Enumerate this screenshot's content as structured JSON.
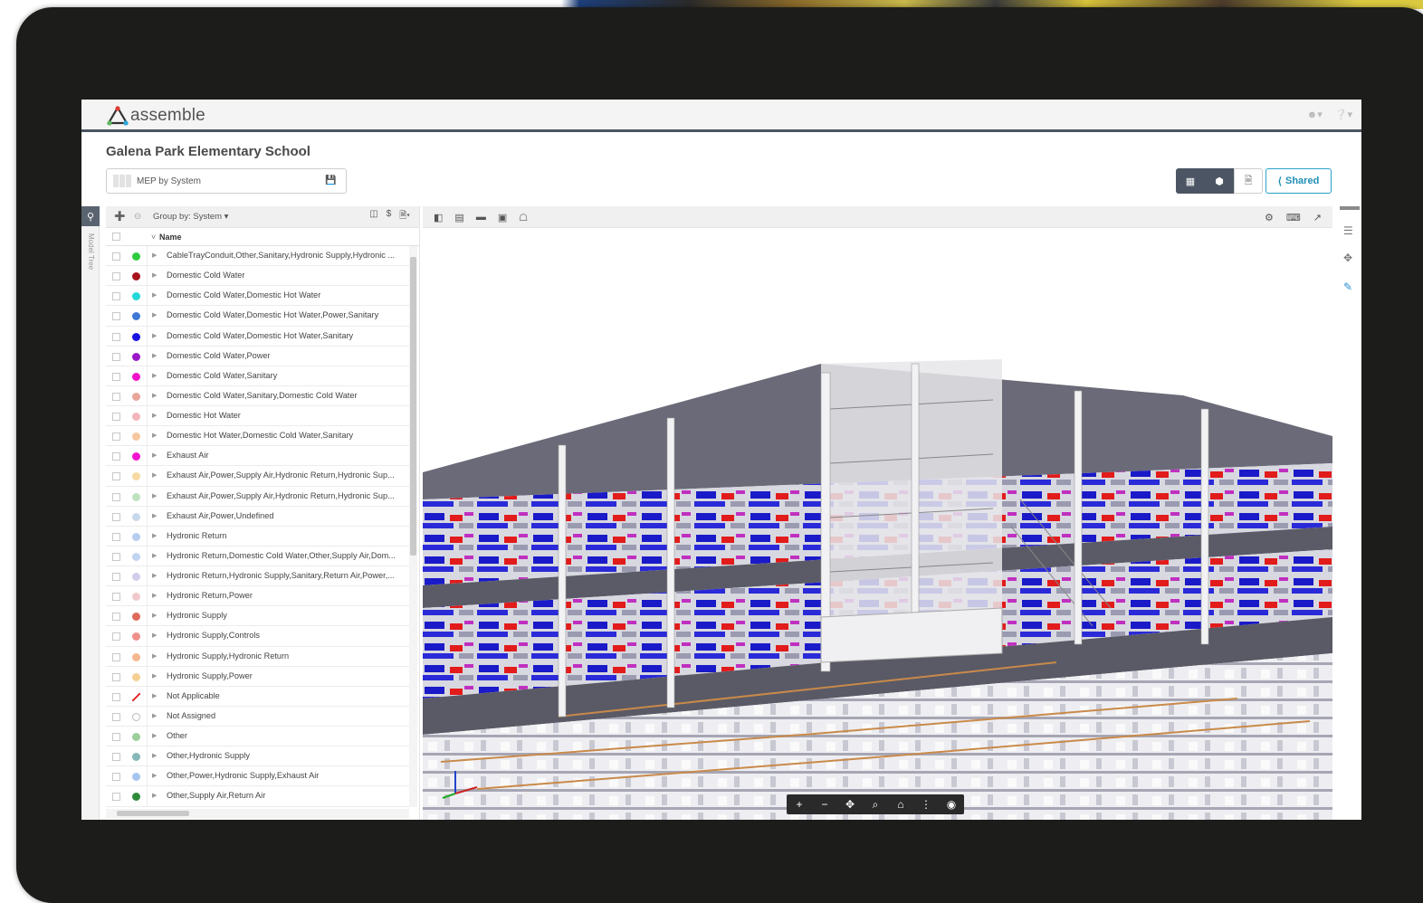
{
  "app": {
    "brand": "assemble",
    "project_title": "Galena Park Elementary School",
    "view_name": "MEP by System",
    "shared_label": "Shared",
    "rail_label": "Model Tree"
  },
  "icons": {
    "user": "user-icon",
    "help": "help-icon",
    "grid": "grid-view-icon",
    "model": "model-view-icon",
    "doc": "document-icon",
    "share": "share-icon"
  },
  "tree": {
    "group_by": "Group by: System",
    "column_name": "Name",
    "rows": [
      {
        "label": "CableTrayConduit,Other,Sanitary,Hydronic Supply,Hydronic ...",
        "color": "#2ecc40"
      },
      {
        "label": "Domestic Cold Water",
        "color": "#a8121a"
      },
      {
        "label": "Domestic Cold Water,Domestic Hot Water",
        "color": "#22d8d8"
      },
      {
        "label": "Domestic Cold Water,Domestic Hot Water,Power,Sanitary",
        "color": "#3f78d6"
      },
      {
        "label": "Domestic Cold Water,Domestic Hot Water,Sanitary",
        "color": "#1b14e0"
      },
      {
        "label": "Domestic Cold Water,Power",
        "color": "#9a18c8"
      },
      {
        "label": "Domestic Cold Water,Sanitary",
        "color": "#f012c8"
      },
      {
        "label": "Domestic Cold Water,Sanitary,Domestic Cold Water",
        "color": "#e9a59a"
      },
      {
        "label": "Domestic Hot Water",
        "color": "#f3b5b9"
      },
      {
        "label": "Domestic Hot Water,Domestic Cold Water,Sanitary",
        "color": "#f7c7a0"
      },
      {
        "label": "Exhaust Air",
        "color": "#f212d0"
      },
      {
        "label": "Exhaust Air,Power,Supply Air,Hydronic Return,Hydronic Sup...",
        "color": "#f8d9a0"
      },
      {
        "label": "Exhaust Air,Power,Supply Air,Hydronic Return,Hydronic Sup...",
        "color": "#bfe2bf"
      },
      {
        "label": "Exhaust Air,Power,Undefined",
        "color": "#c8d8ea"
      },
      {
        "label": "Hydronic Return",
        "color": "#b8cdee"
      },
      {
        "label": "Hydronic Return,Domestic Cold Water,Other,Supply Air,Dom...",
        "color": "#c0d4f2"
      },
      {
        "label": "Hydronic Return,Hydronic Supply,Sanitary,Return Air,Power,...",
        "color": "#d2cdea"
      },
      {
        "label": "Hydronic Return,Power",
        "color": "#f0c8cc"
      },
      {
        "label": "Hydronic Supply",
        "color": "#e06a5a"
      },
      {
        "label": "Hydronic Supply,Controls",
        "color": "#f0908a"
      },
      {
        "label": "Hydronic Supply,Hydronic Return",
        "color": "#f4b78e"
      },
      {
        "label": "Hydronic Supply,Power",
        "color": "#f6cf92"
      },
      {
        "label": "Not Applicable",
        "color": "none-red"
      },
      {
        "label": "Not Assigned",
        "color": "#ffffff"
      },
      {
        "label": "Other",
        "color": "#9ccf9c"
      },
      {
        "label": "Other,Hydronic Supply",
        "color": "#86b8b8"
      },
      {
        "label": "Other,Power,Hydronic Supply,Exhaust Air",
        "color": "#a6c6f0"
      },
      {
        "label": "Other,Supply Air,Return Air",
        "color": "#2e8b3a"
      }
    ]
  },
  "viewer": {
    "nav_tools": [
      "+",
      "−",
      "✥",
      "⌕",
      "⌂",
      "⋮",
      "◉"
    ]
  }
}
